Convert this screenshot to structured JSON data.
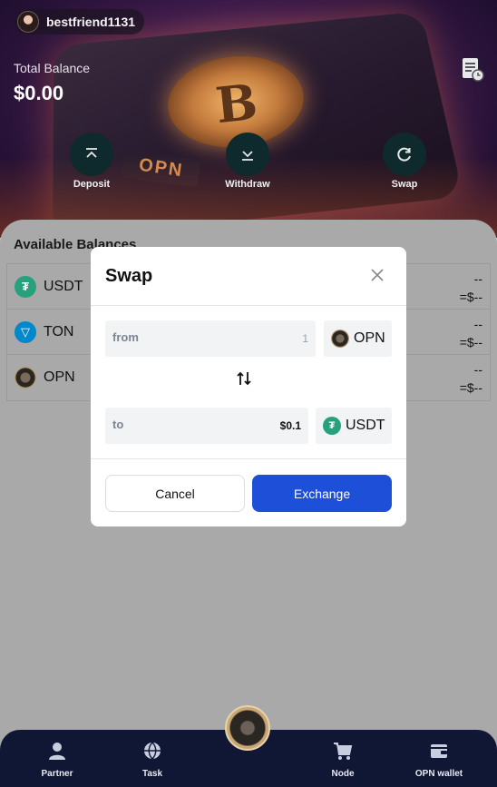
{
  "header": {
    "username": "bestfriend1131",
    "total_balance_label": "Total Balance",
    "total_balance_value": "$0.00",
    "hero_plate_text": "OPN",
    "hero_coin_letter": "B"
  },
  "actions": [
    {
      "label": "Deposit",
      "icon": "deposit-arrow-up-icon"
    },
    {
      "label": "Withdraw",
      "icon": "withdraw-arrow-down-icon"
    },
    {
      "label": "Swap",
      "icon": "swap-refresh-icon"
    }
  ],
  "balances": {
    "title": "Available Balances",
    "rows": [
      {
        "name": "USDT",
        "amount": "--",
        "usd": "=$--",
        "icon": "usdt-icon"
      },
      {
        "name": "TON",
        "amount": "--",
        "usd": "=$--",
        "icon": "ton-icon"
      },
      {
        "name": "OPN",
        "amount": "--",
        "usd": "=$--",
        "icon": "opn-icon"
      }
    ]
  },
  "modal": {
    "title": "Swap",
    "from_label": "from",
    "from_value": "1",
    "from_token": "OPN",
    "to_label": "to",
    "to_value": "$0.1",
    "to_token": "USDT",
    "cancel_label": "Cancel",
    "exchange_label": "Exchange"
  },
  "nav": {
    "items": [
      {
        "label": "Partner",
        "icon": "partner-user-icon"
      },
      {
        "label": "Task",
        "icon": "task-globe-icon"
      },
      {
        "label": "Node",
        "icon": "node-cart-icon"
      },
      {
        "label": "OPN wallet",
        "icon": "wallet-icon"
      }
    ]
  },
  "colors": {
    "accent": "#1e4fd8",
    "usdt": "#26a17b",
    "ton": "#0088cc",
    "nav_bg": "#101735"
  }
}
